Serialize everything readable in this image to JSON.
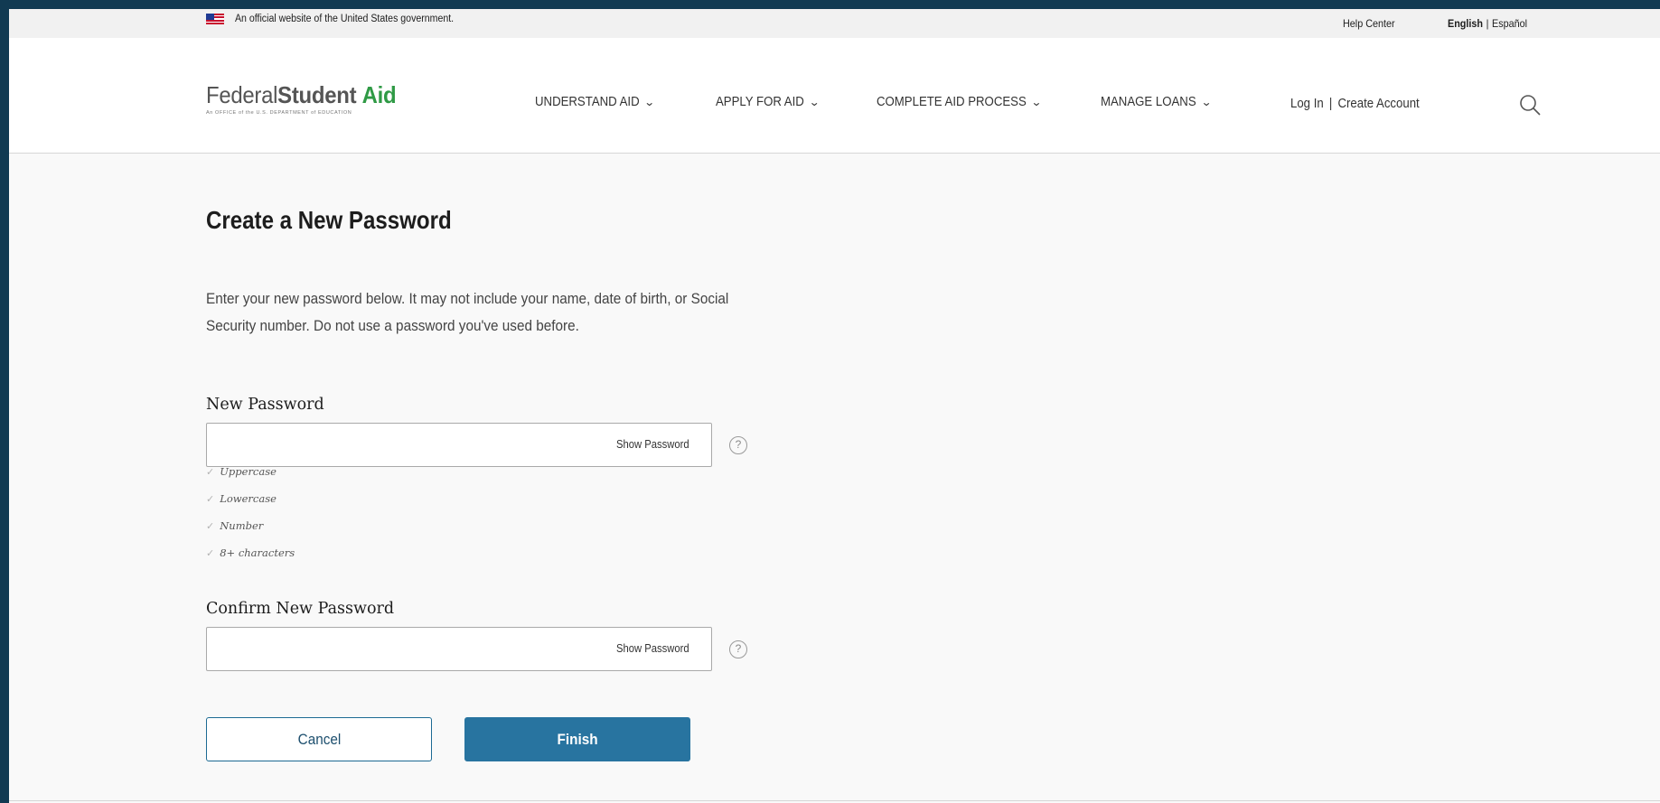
{
  "gov_banner": {
    "official_text": "An official website of the United States government.",
    "help_center": "Help Center",
    "lang_english": "English",
    "lang_separator": "|",
    "lang_spanish": "Español"
  },
  "header": {
    "logo": {
      "federal": "Federal",
      "student": "Student",
      "aid": "Aid",
      "subtitle": "An OFFICE of the U.S. DEPARTMENT of EDUCATION"
    },
    "nav": [
      {
        "label": "UNDERSTAND AID"
      },
      {
        "label": "APPLY FOR AID"
      },
      {
        "label": "COMPLETE AID PROCESS"
      },
      {
        "label": "MANAGE LOANS"
      }
    ],
    "account": {
      "login": "Log In",
      "separator": "|",
      "create": "Create Account"
    },
    "icons": {
      "search": "search-icon",
      "chevron": "chevron-down-icon"
    }
  },
  "main": {
    "title": "Create a New Password",
    "intro": "Enter your new password below. It may not include your name, date of birth, or Social Security number. Do not use a password you've used before.",
    "new_password": {
      "label": "New Password",
      "value": "",
      "show_label": "Show Password",
      "help_glyph": "?"
    },
    "requirements": [
      {
        "label": "Uppercase"
      },
      {
        "label": "Lowercase"
      },
      {
        "label": "Number"
      },
      {
        "label": "8+ characters"
      }
    ],
    "confirm_password": {
      "label": "Confirm New Password",
      "value": "",
      "show_label": "Show Password",
      "help_glyph": "?"
    },
    "buttons": {
      "cancel": "Cancel",
      "finish": "Finish"
    }
  },
  "colors": {
    "outer_frame": "#113a52",
    "primary": "#2874a0",
    "logo_green": "#2f9a45"
  }
}
